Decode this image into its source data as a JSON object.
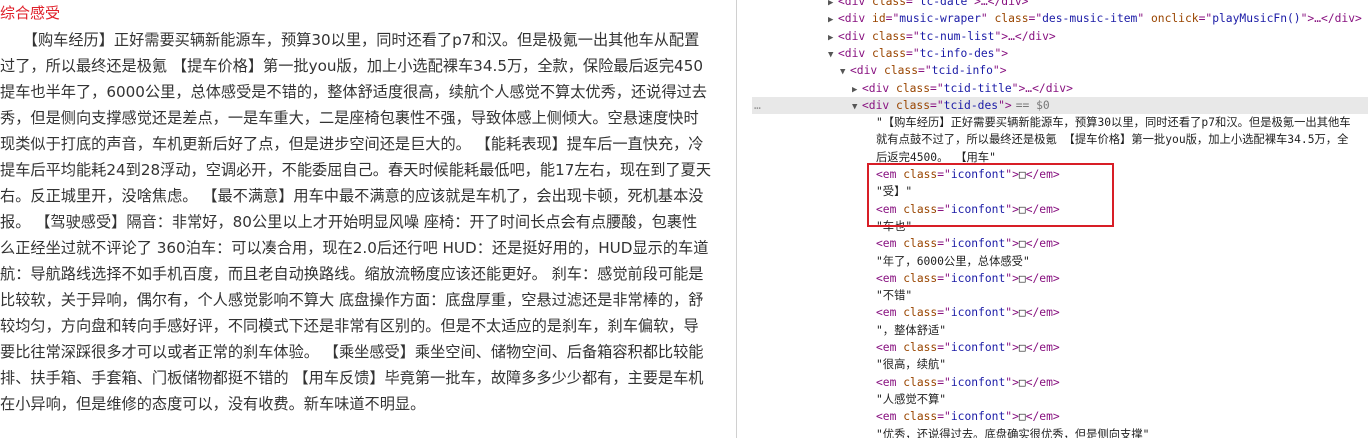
{
  "article": {
    "heading": "综合感受",
    "lines": [
      "　　【购车经历】正好需要买辆新能源车，预算30以里，同时还看了p7和汉。但是极氪一出其他车从配置",
      "过了，所以最终还是极氪 【提车价格】第一批you版，加上小选配裸车34.5万，全款，保险最后返完450",
      "提车也半年了，6000公里，总体感受是不错的，整体舒适度很高，续航个人感觉不算太优秀，还说得过去",
      "秀，但是侧向支撑感觉还是差点，一是车重大，二是座椅包裹性不强，导致体感上侧倾大。空悬速度快时",
      "现类似于打底的声音，车机更新后好了点，但是进步空间还是巨大的。 【能耗表现】提车后一直快充，冷",
      "提车后平均能耗24到28浮动，空调必开，不能委屈自己。春天时候能耗最低吧，能17左右，现在到了夏天",
      "右。反正城里开，没啥焦虑。 【最不满意】用车中最不满意的应该就是车机了，会出现卡顿，死机基本没",
      "报。 【驾驶感受】隔音：非常好，80公里以上才开始明显风噪 座椅：开了时间长点会有点腰酸，包裹性",
      "么正经坐过就不评论了 360泊车：可以凑合用，现在2.0后还行吧 HUD：还是挺好用的，HUD显示的车道",
      "航：导航路线选择不如手机百度，而且老自动换路线。缩放流畅度应该还能更好。 刹车：感觉前段可能是",
      "比较软，关于异响，偶尔有，个人感觉影响不算大 底盘操作方面：底盘厚重，空悬过滤还是非常棒的，舒",
      "较均匀，方向盘和转向手感好评，不同模式下还是非常有区别的。但是不太适应的是刹车，刹车偏软，导",
      "要比往常深踩很多才可以或者正常的刹车体验。 【乘坐感受】乘坐空间、储物空间、后备箱容积都比较能",
      "排、扶手箱、手套箱、门板储物都挺不错的 【用车反馈】毕竟第一批车，故障多多少少都有，主要是车机",
      "在小异响，但是维修的态度可以，没有收费。新车味道不明显。"
    ]
  },
  "devtools": {
    "rows": [
      {
        "tag": "div",
        "attrs": [
          [
            "class",
            "tc-date"
          ]
        ],
        "collapsed": true,
        "tail": ">…</div>"
      },
      {
        "tag": "div",
        "attrs": [
          [
            "id",
            "music-wraper"
          ],
          [
            "class",
            "des-music-item"
          ],
          [
            "onclick",
            "playMusicFn()"
          ]
        ],
        "collapsed": true,
        "tail": ">…</div>"
      },
      {
        "tag": "div",
        "attrs": [
          [
            "class",
            "tc-num-list"
          ]
        ],
        "collapsed": true,
        "tail": ">…</div>"
      },
      {
        "tag": "div",
        "attrs": [
          [
            "class",
            "tc-info-des"
          ]
        ],
        "collapsed": false,
        "tail": ">"
      },
      {
        "tag": "div",
        "attrs": [
          [
            "class",
            "tcid-info"
          ]
        ],
        "collapsed": false,
        "tail": ">"
      },
      {
        "tag": "div",
        "attrs": [
          [
            "class",
            "tcid-title"
          ]
        ],
        "collapsed": true,
        "tail": ">…</div>"
      },
      {
        "tag": "div",
        "attrs": [
          [
            "class",
            "tcid-des"
          ]
        ],
        "collapsed": false,
        "tail": ">",
        "marker": "== $0"
      }
    ],
    "selected_text": [
      "\"【购车经历】正好需要买辆新能源车，预算30以里，同时还看了p7和汉。但是极氪一出其他车",
      "就有点鼓不过了，所以最终还是极氪 【提车价格】第一批you版，加上小选配裸车34.5万，全",
      "后返完4500。 【用车\""
    ],
    "children": [
      {
        "type": "em",
        "class": "iconfont",
        "glyph": "□"
      },
      {
        "type": "text",
        "value": "\"受】\""
      },
      {
        "type": "em",
        "class": "iconfont",
        "glyph": "□"
      },
      {
        "type": "text",
        "value": "\"车也\""
      },
      {
        "type": "em",
        "class": "iconfont",
        "glyph": "□"
      },
      {
        "type": "text",
        "value": "\"年了，6000公里，总体感受\""
      },
      {
        "type": "em",
        "class": "iconfont",
        "glyph": "□"
      },
      {
        "type": "text",
        "value": "\"不错\""
      },
      {
        "type": "em",
        "class": "iconfont",
        "glyph": "□"
      },
      {
        "type": "text",
        "value": "\"，整体舒适\""
      },
      {
        "type": "em",
        "class": "iconfont",
        "glyph": "□"
      },
      {
        "type": "text",
        "value": "\"很高，续航\""
      },
      {
        "type": "em",
        "class": "iconfont",
        "glyph": "□"
      },
      {
        "type": "text",
        "value": "\"人感觉不算\""
      },
      {
        "type": "em",
        "class": "iconfont",
        "glyph": "□"
      },
      {
        "type": "text",
        "value": "\"优秀，还说得过去。底盘确实很优秀，但是侧向支撑\""
      }
    ],
    "ellipsis": "…",
    "colors": {
      "highlight": "#d81e26",
      "tag": "#881280",
      "attr": "#994500",
      "value": "#1a1aa6"
    }
  }
}
